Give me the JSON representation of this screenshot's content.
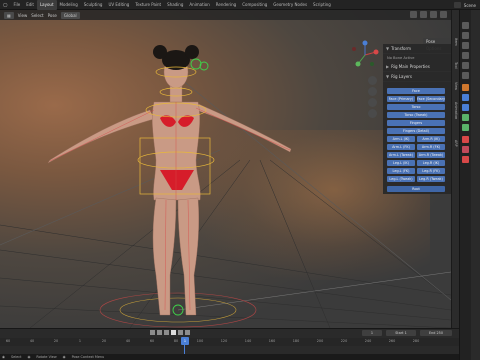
{
  "topbar": {
    "tabs": [
      "Layout",
      "Modeling",
      "Sculpting",
      "UV Editing",
      "Texture Paint",
      "Shading",
      "Animation",
      "Rendering",
      "Compositing",
      "Geometry Nodes",
      "Scripting"
    ],
    "active_tab": "Layout",
    "scene_label": "Scene"
  },
  "viewport": {
    "transform_orientation": "Global",
    "pose_options": "Pose Options"
  },
  "npanel": {
    "transform_title": "Transform",
    "no_bone_active": "No Bone Active",
    "rig_main_title": "Rig Main Properties",
    "rig_layers_title": "Rig Layers",
    "layers": {
      "face": "Face",
      "face_primary": "Face (Primary)",
      "face_secondary": "Face (Secondary)",
      "torso": "Torso",
      "torso_tweak": "Torso (Tweak)",
      "fingers": "Fingers",
      "fingers_detail": "Fingers (Detail)",
      "arm_l_ik": "Arm.L (IK)",
      "arm_r_ik": "Arm.R (IK)",
      "arm_l_fk": "Arm.L (FK)",
      "arm_r_fk": "Arm.R (FK)",
      "arm_l_tweak": "Arm.L (Tweak)",
      "arm_r_tweak": "Arm.R (Tweak)",
      "leg_l_ik": "Leg.L (IK)",
      "leg_r_ik": "Leg.R (IK)",
      "leg_l_fk": "Leg.L (FK)",
      "leg_r_fk": "Leg.R (FK)",
      "leg_l_tweak": "Leg.L (Tweak)",
      "leg_r_tweak": "Leg.R (Tweak)",
      "root": "Root"
    }
  },
  "sidetabs": [
    "Item",
    "Tool",
    "View",
    "Animation",
    "ARP"
  ],
  "timeline": {
    "current_frame": "1",
    "start_label": "Start",
    "start_value": "1",
    "end_label": "End",
    "end_value": "250",
    "ticks": [
      "60",
      "40",
      "20",
      "1",
      "20",
      "40",
      "60",
      "80",
      "100",
      "120",
      "140",
      "160",
      "180",
      "200",
      "220",
      "240",
      "260",
      "280"
    ]
  },
  "statusbar": {
    "items": [
      "Select",
      "Rotate View",
      "Pose Context Menu"
    ]
  },
  "colors": {
    "accent": "#4a72b5",
    "rig_rings": "#e8b83a",
    "ik_green": "#3fd24a",
    "bone_red": "#d84848"
  }
}
